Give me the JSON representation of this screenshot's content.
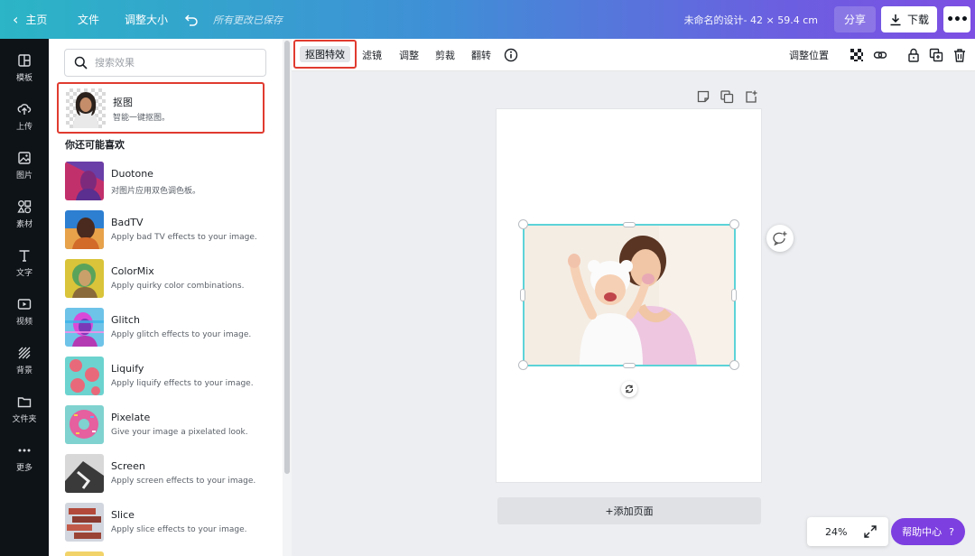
{
  "topbar": {
    "home_label": "主页",
    "file_label": "文件",
    "resize_label": "调整大小",
    "undo_icon": "undo-icon",
    "saved_status": "所有更改已保存",
    "document_title": "未命名的设计- 42 × 59.4 cm",
    "share_label": "分享",
    "download_label": "下载",
    "more_label": "•••",
    "gradient_colors": [
      "#2bb5c6",
      "#3f8fd6",
      "#6b5fe0",
      "#7d4fe3"
    ]
  },
  "sidebar": {
    "items": [
      {
        "label": "模板",
        "icon": "template-icon"
      },
      {
        "label": "上传",
        "icon": "upload-icon"
      },
      {
        "label": "图片",
        "icon": "image-icon"
      },
      {
        "label": "素材",
        "icon": "elements-icon"
      },
      {
        "label": "文字",
        "icon": "text-icon"
      },
      {
        "label": "视频",
        "icon": "video-icon"
      },
      {
        "label": "背景",
        "icon": "background-icon"
      },
      {
        "label": "文件夹",
        "icon": "folder-icon"
      },
      {
        "label": "更多",
        "icon": "more-icon"
      }
    ]
  },
  "panel": {
    "search_placeholder": "搜索效果",
    "featured": {
      "title": "抠图",
      "subtitle": "智能一键抠图。"
    },
    "section_title": "你还可能喜欢",
    "effects": [
      {
        "title": "Duotone",
        "subtitle": "对图片应用双色调色板。",
        "colors": [
          "#c2306b",
          "#6a3fa8"
        ]
      },
      {
        "title": "BadTV",
        "subtitle": "Apply bad TV effects to your image.",
        "colors": [
          "#2d7fd2",
          "#e8a24a"
        ]
      },
      {
        "title": "ColorMix",
        "subtitle": "Apply quirky color combinations.",
        "colors": [
          "#d9c43a",
          "#5aa35b"
        ]
      },
      {
        "title": "Glitch",
        "subtitle": "Apply glitch effects to your image.",
        "colors": [
          "#3ab4e8",
          "#d94ad9"
        ]
      },
      {
        "title": "Liquify",
        "subtitle": "Apply liquify effects to your image.",
        "colors": [
          "#6cd3cf",
          "#e86a7a"
        ]
      },
      {
        "title": "Pixelate",
        "subtitle": "Give your image a pixelated look.",
        "colors": [
          "#7fd2cf",
          "#e65f9e"
        ]
      },
      {
        "title": "Screen",
        "subtitle": "Apply screen effects to your image.",
        "colors": [
          "#3a3a3a",
          "#d8d8d8"
        ]
      },
      {
        "title": "Slice",
        "subtitle": "Apply slice effects to your image.",
        "colors": [
          "#b5b9c2",
          "#b2493a"
        ]
      }
    ]
  },
  "image_toolbar": {
    "tools": [
      "抠图特效",
      "滤镜",
      "调整",
      "剪裁",
      "翻转"
    ],
    "position_label": "调整位置"
  },
  "canvas": {
    "add_page_label": "+添加页面",
    "zoom_value": "24%",
    "help_label": "帮助中心",
    "help_icon": "?",
    "selection_color": "#5cd3d8",
    "highlight_color": "#e03b2f"
  }
}
